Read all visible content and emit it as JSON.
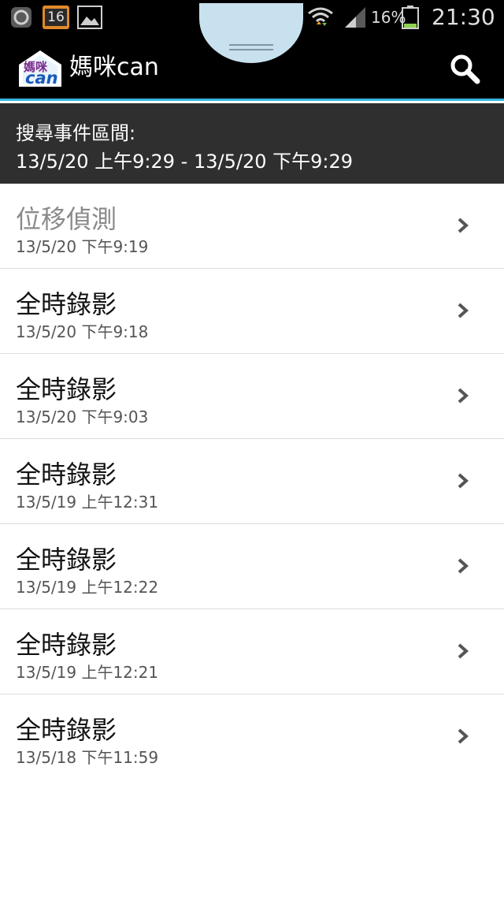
{
  "status_bar": {
    "notification_badge": "16",
    "battery_percent": "16%",
    "time": "21:30",
    "icons": [
      "messenger-icon",
      "calendar-icon",
      "gallery-icon",
      "wifi-icon",
      "signal-icon",
      "battery-icon"
    ]
  },
  "app_bar": {
    "title": "媽咪can",
    "logo_text_top": "媽咪",
    "logo_text_bottom": "can",
    "search_icon": "search-icon",
    "accent_color": "#33b5e5"
  },
  "range": {
    "label": "搜尋事件區間:",
    "value": "13/5/20 上午9:29 - 13/5/20 下午9:29"
  },
  "events": [
    {
      "name": "位移偵測",
      "time": "13/5/20 下午9:19"
    },
    {
      "name": "全時錄影",
      "time": "13/5/20 下午9:18"
    },
    {
      "name": "全時錄影",
      "time": "13/5/20 下午9:03"
    },
    {
      "name": "全時錄影",
      "time": "13/5/19 上午12:31"
    },
    {
      "name": "全時錄影",
      "time": "13/5/19 上午12:22"
    },
    {
      "name": "全時錄影",
      "time": "13/5/19 上午12:21"
    },
    {
      "name": "全時錄影",
      "time": "13/5/18 下午11:59"
    }
  ]
}
